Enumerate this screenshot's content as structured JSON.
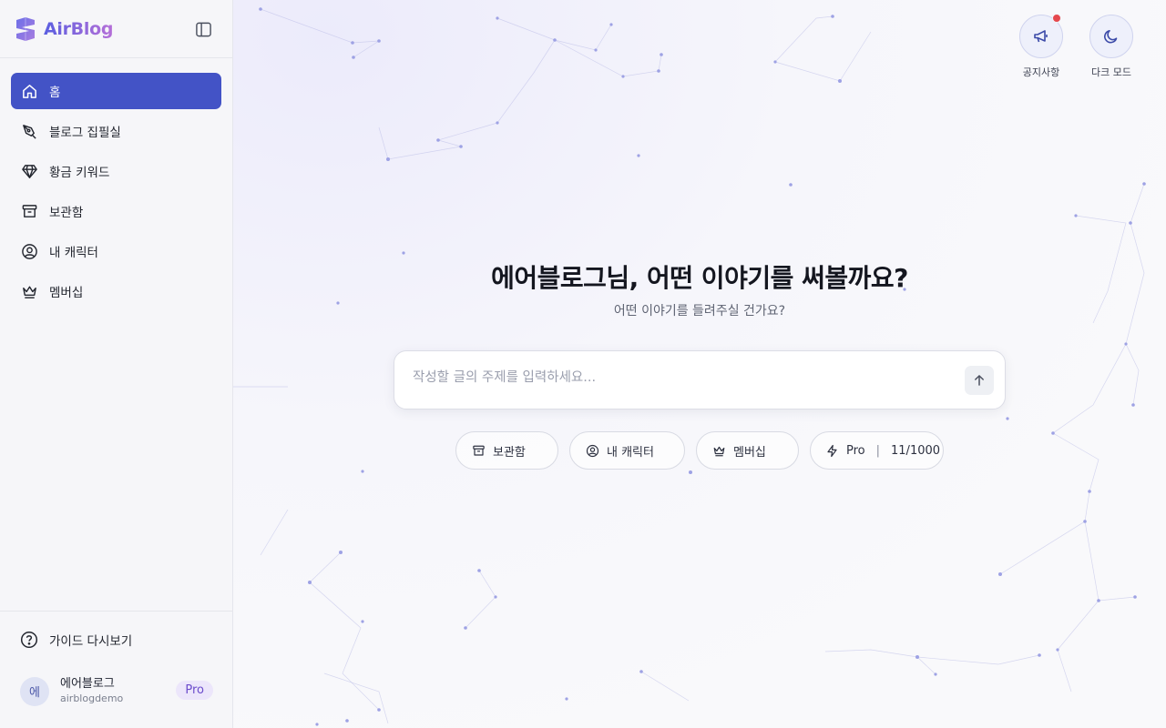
{
  "brand": {
    "name": "AirBlog"
  },
  "nav": {
    "items": [
      {
        "label": "홈",
        "icon": "home-icon",
        "active": true
      },
      {
        "label": "블로그 집필실",
        "icon": "pen-nib-icon",
        "active": false
      },
      {
        "label": "황금 키워드",
        "icon": "diamond-icon",
        "active": false
      },
      {
        "label": "보관함",
        "icon": "archive-icon",
        "active": false
      },
      {
        "label": "내 캐릭터",
        "icon": "user-circle-icon",
        "active": false
      },
      {
        "label": "멤버십",
        "icon": "crown-icon",
        "active": false
      }
    ]
  },
  "sidebar_bottom": {
    "guide_label": "가이드 다시보기",
    "user": {
      "avatar_initial": "에",
      "name": "에어블로그",
      "id": "airblogdemo",
      "plan": "Pro"
    }
  },
  "top_actions": {
    "notice_label": "공지사항",
    "dark_mode_label": "다크 모드"
  },
  "main": {
    "headline": "에어블로그님, 어떤 이야기를 써볼까요?",
    "subline": "어떤 이야기를 들려주실 건가요?",
    "input_placeholder": "작성할 글의 주제를 입력하세요...",
    "chips": {
      "archive": "보관함",
      "character": "내 캐릭터",
      "membership": "멤버십",
      "plan": "Pro",
      "usage": "11/1000"
    }
  },
  "colors": {
    "accent": "#4353c6",
    "notif_dot": "#e5484d",
    "pro_badge_text": "#6b4ccc"
  }
}
